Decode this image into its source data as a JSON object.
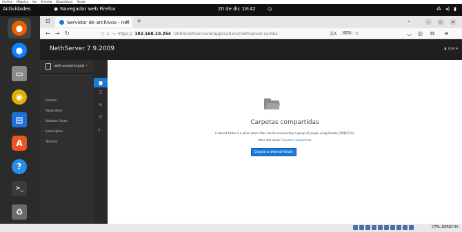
{
  "host_menu": [
    "Archivo",
    "Máquina",
    "Ver",
    "Entrada",
    "Dispositivos",
    "Ayuda"
  ],
  "topbar": {
    "activities": "Actividades",
    "app_name": "Navegador web Firefox",
    "clock": "20 de dic  18:42"
  },
  "dock": {
    "items": [
      {
        "name": "firefox",
        "color": "#e66000",
        "glyph": "●"
      },
      {
        "name": "thunderbird",
        "color": "#0a84ff",
        "glyph": "●"
      },
      {
        "name": "files",
        "color": "#7a7a7a",
        "glyph": "▭"
      },
      {
        "name": "rhythmbox",
        "color": "#e0b000",
        "glyph": "◉"
      },
      {
        "name": "writer",
        "color": "#1e6fd9",
        "glyph": "▤"
      },
      {
        "name": "software",
        "color": "#e95420",
        "glyph": "A"
      },
      {
        "name": "help",
        "color": "#2b8ce5",
        "glyph": "?"
      },
      {
        "name": "terminal",
        "color": "#3a3a3a",
        "glyph": ">_"
      },
      {
        "name": "trash",
        "color": "#6b6b6b",
        "glyph": "♻"
      }
    ]
  },
  "browser": {
    "tab_title": "Servidor de archivos - net",
    "url_prefix": "https://",
    "url_host": "192.168.10.254",
    "url_rest": ":9090/nethserver#/applications/nethserver-samba",
    "zoom": "80%"
  },
  "nethserver": {
    "brand": "NethServer 7.9.2009",
    "user_menu": "root"
  },
  "sidebar": {
    "host": "neth.server.ingnd",
    "items": [
      "Sistema",
      "Applications",
      "Software Center",
      "Subscription",
      "Terminal"
    ]
  },
  "content": {
    "title": "Carpetas compartidas",
    "description": "A shared folder is a place where files can be accessed by a group of people using Samba (SMB/CIFS).",
    "more_info_prefix": "More info about",
    "more_info_link": "Carpetas compartidas",
    "create_button": "Create a shared folder"
  },
  "statusbar": {
    "host_key": "CTRL DERECHA"
  }
}
